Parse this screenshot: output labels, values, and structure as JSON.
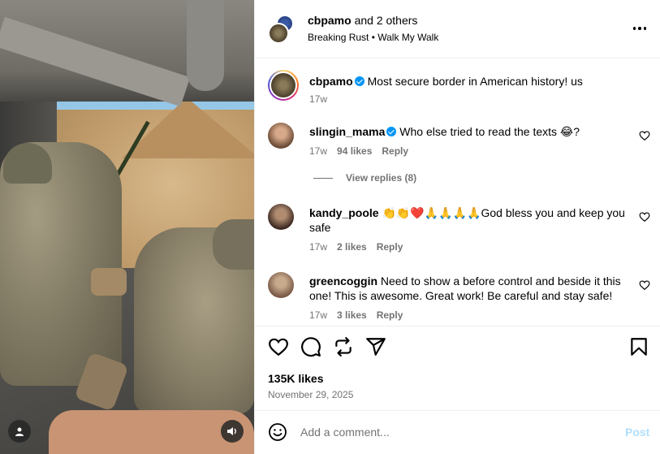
{
  "header": {
    "primary_user": "cbpamo",
    "others": "and 2 others",
    "audio": "Breaking Rust • Walk My Walk"
  },
  "caption": {
    "username": "cbpamo",
    "text": "Most secure border in American history! us",
    "time": "17w"
  },
  "comments": [
    {
      "username": "slingin_mama",
      "verified": true,
      "text": "Who else tried to read the texts 😂?",
      "time": "17w",
      "likes": "94 likes",
      "reply": "Reply",
      "view_replies": "View replies (8)"
    },
    {
      "username": "kandy_poole",
      "verified": false,
      "text": "👏👏❤️🙏🙏🙏🙏God bless you and keep you safe",
      "time": "17w",
      "likes": "2 likes",
      "reply": "Reply"
    },
    {
      "username": "greencoggin",
      "verified": false,
      "text": "Need to show a before control and beside it this one! This is awesome. Great work! Be careful and stay safe!",
      "time": "17w",
      "likes": "3 likes",
      "reply": "Reply"
    }
  ],
  "post": {
    "likes": "135K likes",
    "date": "November 29, 2025"
  },
  "composer": {
    "placeholder": "Add a comment...",
    "post_label": "Post"
  },
  "colors": {
    "verified": "#0095f6",
    "secondary_text": "#737373",
    "post_disabled": "#b2dffc",
    "divider": "#efefef"
  },
  "icons": [
    "more-icon",
    "heart-icon",
    "comment-icon",
    "repost-icon",
    "share-icon",
    "bookmark-icon",
    "emoji-icon",
    "user-tag-icon",
    "sound-icon"
  ]
}
